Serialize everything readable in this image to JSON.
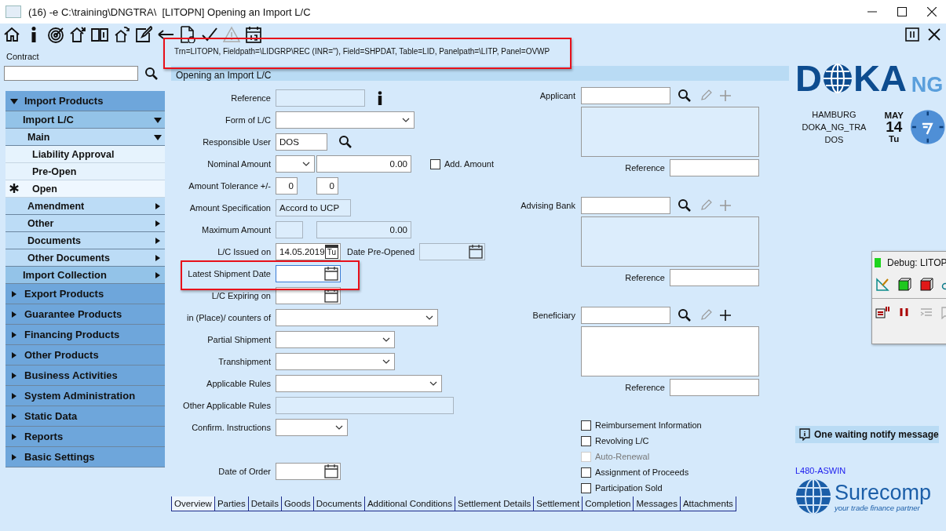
{
  "window": {
    "title": "(16) -e C:\\training\\DNGTRA\\  [LITOPN] Opening an Import L/C"
  },
  "tooltip": {
    "text": "Trn=LITOPN, Fieldpath=\\LIDGRP\\REC (INR=''), Field=SHPDAT, Table=LID, Panelpath=\\LITP, Panel=OVWP"
  },
  "contract": {
    "label": "Contract"
  },
  "nav": [
    {
      "label": "Import Products",
      "expanded": true,
      "children": [
        {
          "label": "Import L/C",
          "expanded": true,
          "children": [
            {
              "label": "Main",
              "expanded": true,
              "children": [
                {
                  "label": "Liability Approval",
                  "selected": false
                },
                {
                  "label": "Pre-Open",
                  "selected": false
                },
                {
                  "label": "Open",
                  "selected": true
                }
              ]
            },
            {
              "label": "Amendment",
              "expanded": false
            },
            {
              "label": "Other",
              "expanded": false
            },
            {
              "label": "Documents",
              "expanded": false
            },
            {
              "label": "Other Documents",
              "expanded": false
            }
          ]
        },
        {
          "label": "Import Collection",
          "expanded": false
        }
      ]
    },
    {
      "label": "Export Products",
      "expanded": false
    },
    {
      "label": "Guarantee Products",
      "expanded": false
    },
    {
      "label": "Financing Products",
      "expanded": false
    },
    {
      "label": "Other Products",
      "expanded": false
    },
    {
      "label": "Business Activities",
      "expanded": false
    },
    {
      "label": "System Administration",
      "expanded": false
    },
    {
      "label": "Static Data",
      "expanded": false
    },
    {
      "label": "Reports",
      "expanded": false
    },
    {
      "label": "Basic Settings",
      "expanded": false
    }
  ],
  "form": {
    "title": "Opening an Import L/C",
    "fields": [
      {
        "label": "Reference",
        "kind": "text",
        "disabled": true
      },
      {
        "label": "Form of L/C",
        "kind": "select"
      },
      {
        "label": "Responsible User",
        "kind": "text",
        "value": "DOS"
      },
      {
        "label": "Nominal Amount",
        "kind": "amount",
        "amount": "0.00",
        "option": {
          "label": "Add. Amount",
          "checked": false
        }
      },
      {
        "label": "Amount Tolerance +/-",
        "kind": "pair",
        "values": [
          "0",
          "0"
        ]
      },
      {
        "label": "Amount Specification",
        "kind": "text",
        "value": "Accord to UCP",
        "disabled": true
      },
      {
        "label": "Maximum Amount",
        "kind": "amount",
        "amount": "0.00",
        "disabled": true
      },
      {
        "label": "L/C Issued on",
        "kind": "date",
        "value": "14.05.2019",
        "weekday": "Tu",
        "second": {
          "label": "Date Pre-Opened",
          "disabled": true
        }
      },
      {
        "label": "Latest Shipment Date",
        "kind": "date",
        "focused": true
      },
      {
        "label": "L/C Expiring on",
        "kind": "date"
      },
      {
        "label": "in (Place)/ counters of",
        "kind": "select"
      },
      {
        "label": "Partial Shipment",
        "kind": "select"
      },
      {
        "label": "Transhipment",
        "kind": "select"
      },
      {
        "label": "Applicable Rules",
        "kind": "select"
      },
      {
        "label": "Other Applicable Rules",
        "kind": "text",
        "disabled": true
      },
      {
        "label": "Confirm. Instructions",
        "kind": "select"
      },
      {
        "label": "Date of Order",
        "kind": "date"
      }
    ],
    "parties": [
      {
        "label": "Applicant",
        "reference_label": "Reference",
        "disabled": true
      },
      {
        "label": "Advising Bank",
        "reference_label": "Reference",
        "disabled": true
      },
      {
        "label": "Beneficiary",
        "reference_label": "Reference",
        "disabled": false
      }
    ],
    "options": [
      {
        "label": "Reimbursement Information",
        "checked": false,
        "disabled": false
      },
      {
        "label": "Revolving L/C",
        "checked": false,
        "disabled": false
      },
      {
        "label": "Auto-Renewal",
        "checked": false,
        "disabled": true
      },
      {
        "label": "Assignment of Proceeds",
        "checked": false,
        "disabled": false
      },
      {
        "label": "Participation Sold",
        "checked": false,
        "disabled": false
      }
    ]
  },
  "tabs": [
    {
      "label": "Overview",
      "selected": true
    },
    {
      "label": "Parties",
      "selected": false
    },
    {
      "label": "Details",
      "selected": false
    },
    {
      "label": "Goods",
      "selected": false
    },
    {
      "label": "Documents",
      "selected": false
    },
    {
      "label": "Additional Conditions",
      "selected": false
    },
    {
      "label": "Settlement Details",
      "selected": false
    },
    {
      "label": "Settlement",
      "selected": false
    },
    {
      "label": "Completion",
      "selected": false
    },
    {
      "label": "Messages",
      "selected": false
    },
    {
      "label": "Attachments",
      "selected": false
    }
  ],
  "brand": {
    "parts": [
      "D",
      "KA"
    ],
    "suffix": "NG"
  },
  "session": {
    "location": [
      "HAMBURG",
      "DOKA_NG_TRA",
      "DOS"
    ],
    "month": "MAY",
    "day": "14",
    "weekday": "Tu"
  },
  "notify": {
    "text": "One waiting notify message"
  },
  "host": "L480-ASWIN",
  "vendor": {
    "name": "Surecomp",
    "tagline": "your trade finance partner"
  },
  "debug": {
    "title": "Debug: LITOP"
  }
}
